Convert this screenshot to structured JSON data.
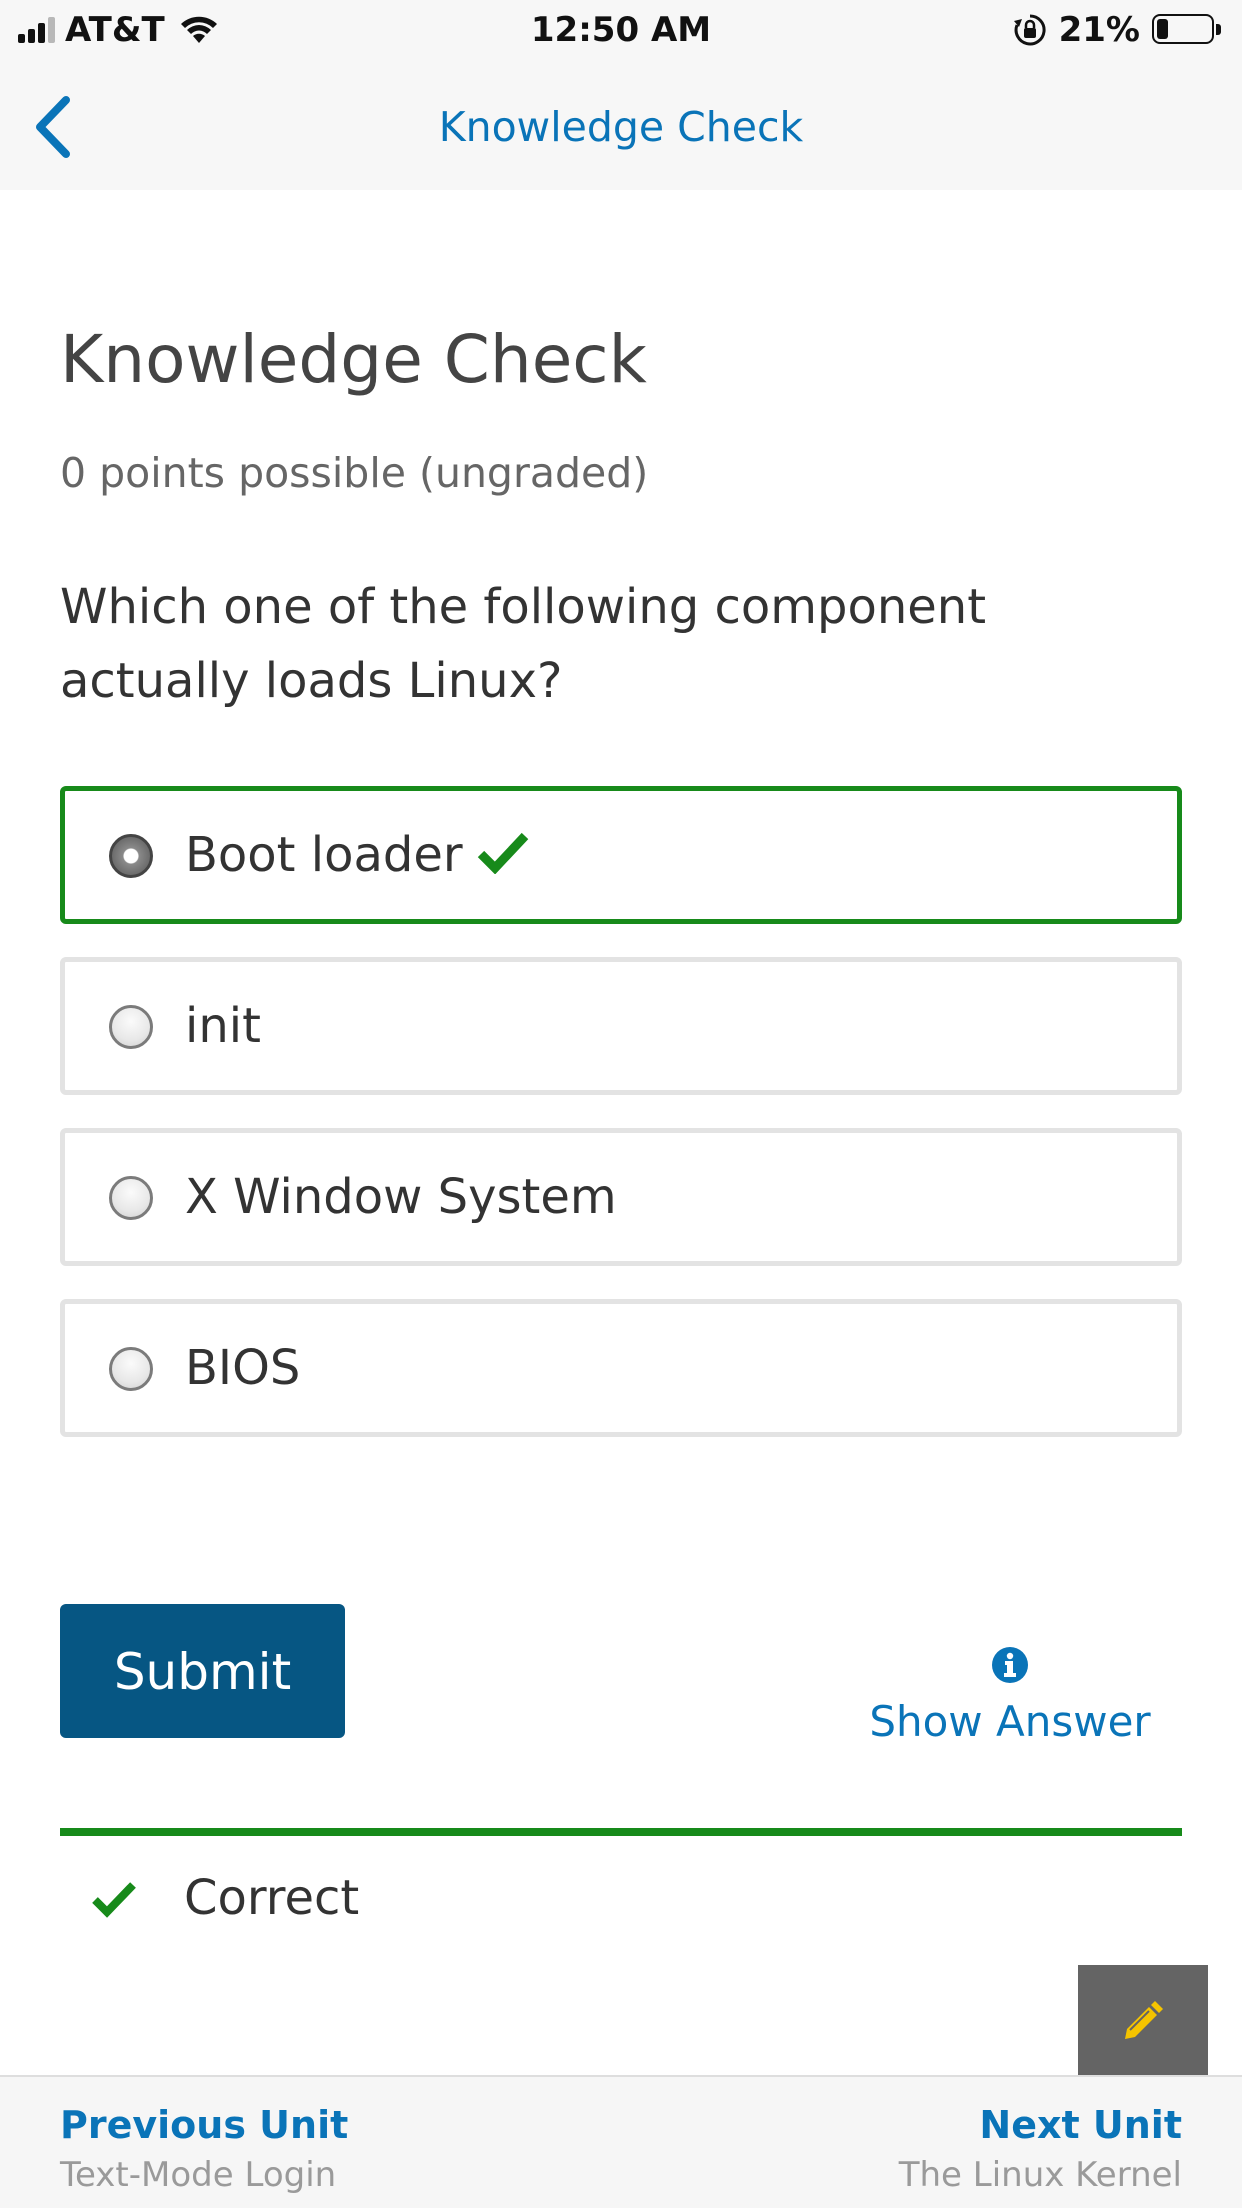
{
  "status_bar": {
    "carrier": "AT&T",
    "time": "12:50 AM",
    "battery_percent": "21%",
    "battery_level": 0.21,
    "signal_bars_active": 3,
    "signal_bars_total": 4
  },
  "nav": {
    "title": "Knowledge Check",
    "back_icon": "chevron-left-icon"
  },
  "problem": {
    "title": "Knowledge Check",
    "points": "0 points possible (ungraded)",
    "question": "Which one of the following component actually loads Linux?",
    "options": [
      {
        "label": "Boot loader",
        "selected": true,
        "correct": true
      },
      {
        "label": "init",
        "selected": false,
        "correct": false
      },
      {
        "label": "X Window System",
        "selected": false,
        "correct": false
      },
      {
        "label": "BIOS",
        "selected": false,
        "correct": false
      }
    ],
    "submit_label": "Submit",
    "show_answer_label": "Show Answer",
    "feedback": "Correct"
  },
  "unit_nav": {
    "previous_label": "Previous Unit",
    "previous_title": "Text-Mode Login",
    "next_label": "Next Unit",
    "next_title": "The Linux Kernel"
  },
  "colors": {
    "accent_blue": "#0a74b8",
    "submit_bg": "#065683",
    "correct_green": "#178a1a",
    "edit_button_bg": "#646464",
    "pencil_yellow": "#f5c400"
  }
}
